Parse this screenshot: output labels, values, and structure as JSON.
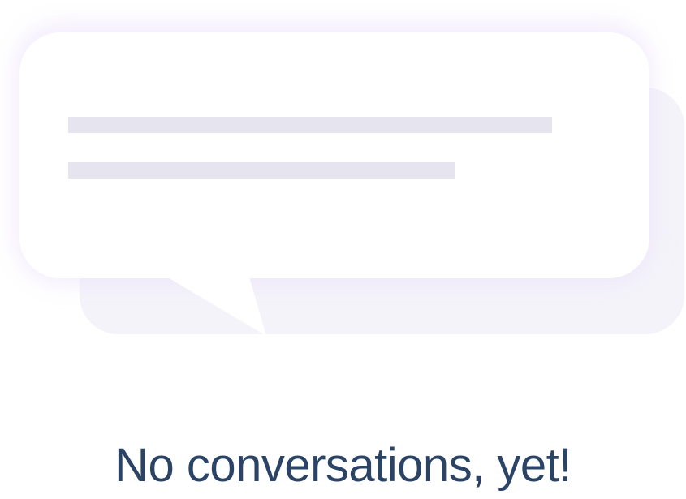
{
  "empty_state": {
    "title": "No conversations, yet!",
    "illustration_icon": "chat-bubbles-icon"
  },
  "colors": {
    "background": "#ffffff",
    "title_text": "#2b4466",
    "front_bubble": "#ffffff",
    "back_bubble": "#f4f3f9",
    "placeholder_line": "#e6e5ef",
    "bubble_glow": "#e9defb"
  }
}
